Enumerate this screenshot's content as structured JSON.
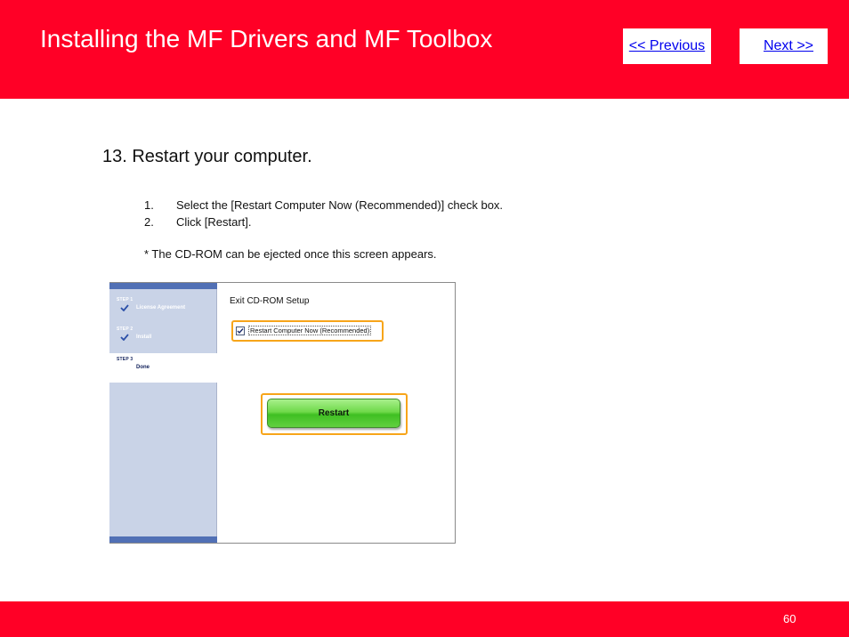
{
  "header": {
    "title": "Installing the MF Drivers and MF Toolbox",
    "prev_label": "<< Previous",
    "next_label": "Next >>"
  },
  "content": {
    "heading": "13. Restart your computer.",
    "instructions": [
      {
        "num": "1.",
        "text": "Select the [Restart Computer Now (Recommended)] check box."
      },
      {
        "num": "2.",
        "text": "Click [Restart]."
      }
    ],
    "note": "* The CD-ROM can be ejected once this screen appears."
  },
  "installer": {
    "steps": [
      {
        "label": "STEP 1",
        "name": "License Agreement",
        "completed": true
      },
      {
        "label": "STEP 2",
        "name": "Install",
        "completed": true
      },
      {
        "label": "STEP 3",
        "name": "Done",
        "completed": false
      }
    ],
    "title": "Exit CD-ROM Setup",
    "checkbox_label": "Restart Computer Now (Recommended)",
    "checkbox_checked": true,
    "restart_button": "Restart"
  },
  "footer": {
    "page_number": "60"
  },
  "colors": {
    "brand_red": "#ff0026",
    "highlight_orange": "#f7a51a",
    "sidebar_blue": "#c9d3e7",
    "button_green": "#6fd94a"
  }
}
